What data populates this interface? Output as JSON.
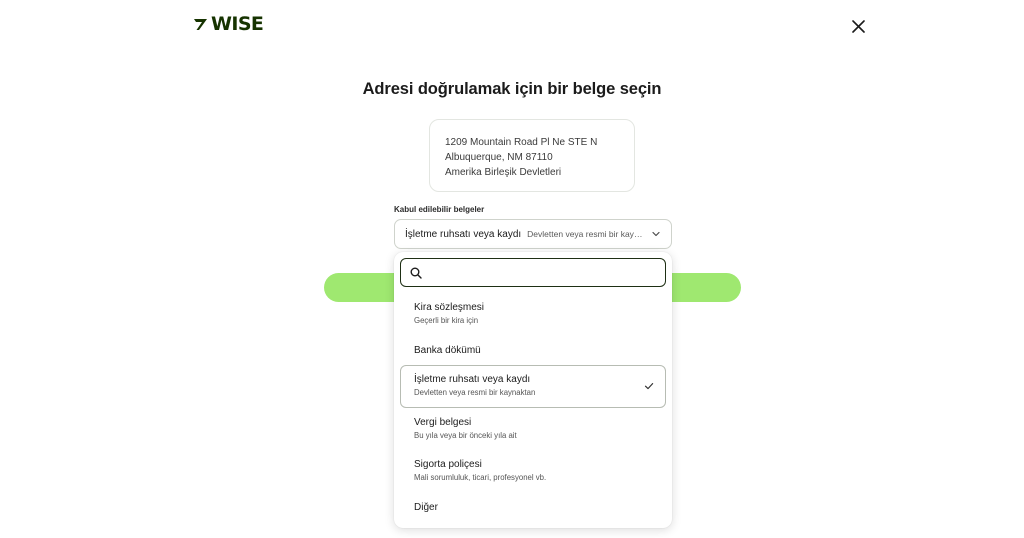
{
  "header": {
    "brand": "WISE",
    "brand_color": "#163300",
    "close_icon": "close-icon"
  },
  "page": {
    "title": "Adresi doğrulamak için bir belge seçin"
  },
  "address": {
    "line1": "1209 Mountain Road Pl Ne STE N",
    "line2": "Albuquerque, NM 87110",
    "line3": "Amerika Birleşik Devletleri"
  },
  "documents": {
    "label": "Kabul edilebilir belgeler",
    "selected_value": "İşletme ruhsatı veya kaydı",
    "selected_description": "Devletten veya resmi bir kaynaktan",
    "search_placeholder": "",
    "options": [
      {
        "label": "Kira sözleşmesi",
        "description": "Geçerli bir kira için"
      },
      {
        "label": "Banka dökümü",
        "description": ""
      },
      {
        "label": "İşletme ruhsatı veya kaydı",
        "description": "Devletten veya resmi bir kaynaktan",
        "selected": true
      },
      {
        "label": "Vergi belgesi",
        "description": "Bu yıla veya bir önceki yıla ait"
      },
      {
        "label": "Sigorta poliçesi",
        "description": "Mali sorumluluk, ticari, profesyonel vb."
      },
      {
        "label": "Diğer",
        "description": ""
      }
    ]
  },
  "colors": {
    "accent_green": "#9fe870",
    "forest": "#163300"
  }
}
